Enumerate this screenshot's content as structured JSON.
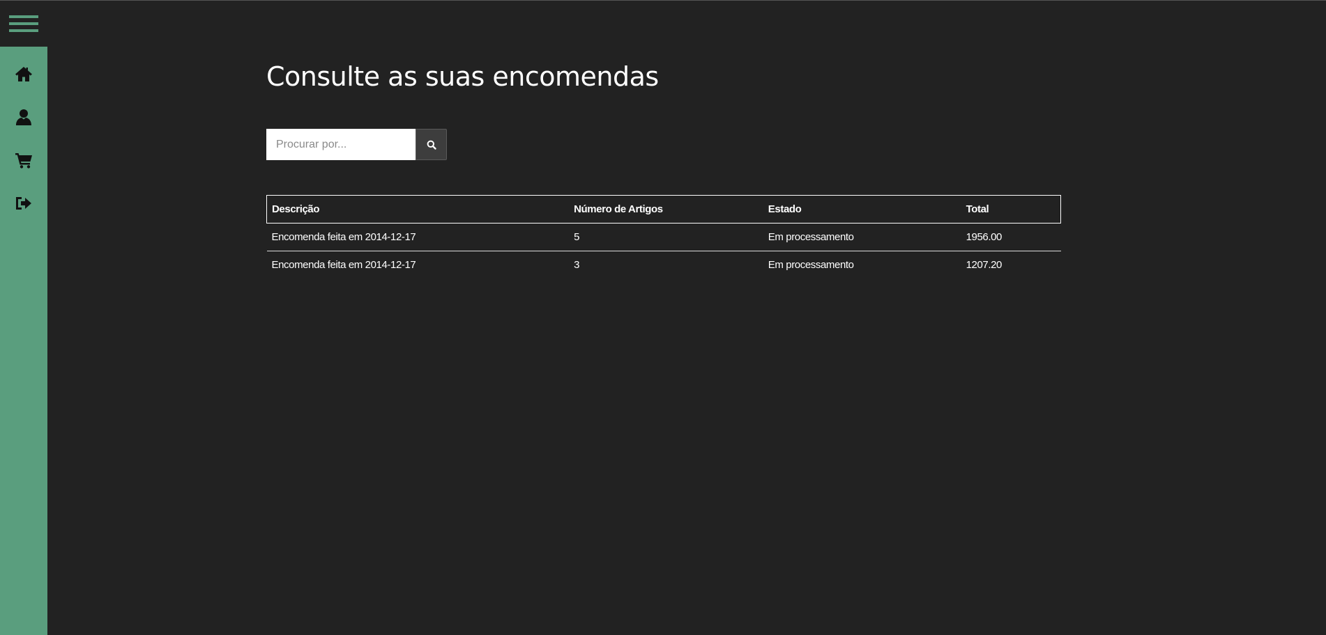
{
  "colors": {
    "background": "#222222",
    "sidebar": "#5a9e7e",
    "menu_icon": "#5a9e7e",
    "text": "#ffffff"
  },
  "sidebar": {
    "items": [
      {
        "icon": "home-icon"
      },
      {
        "icon": "user-icon"
      },
      {
        "icon": "shopping-cart-icon"
      },
      {
        "icon": "sign-out-icon"
      }
    ]
  },
  "page": {
    "title": "Consulte as suas encomendas"
  },
  "search": {
    "placeholder": "Procurar por...",
    "value": "",
    "button_icon": "search-icon"
  },
  "orders_table": {
    "headers": [
      "Descrição",
      "Número de Artigos",
      "Estado",
      "Total"
    ],
    "rows": [
      [
        "Encomenda feita em 2014-12-17",
        "5",
        "Em processamento",
        "1956.00"
      ],
      [
        "Encomenda feita em 2014-12-17",
        "3",
        "Em processamento",
        "1207.20"
      ]
    ]
  }
}
